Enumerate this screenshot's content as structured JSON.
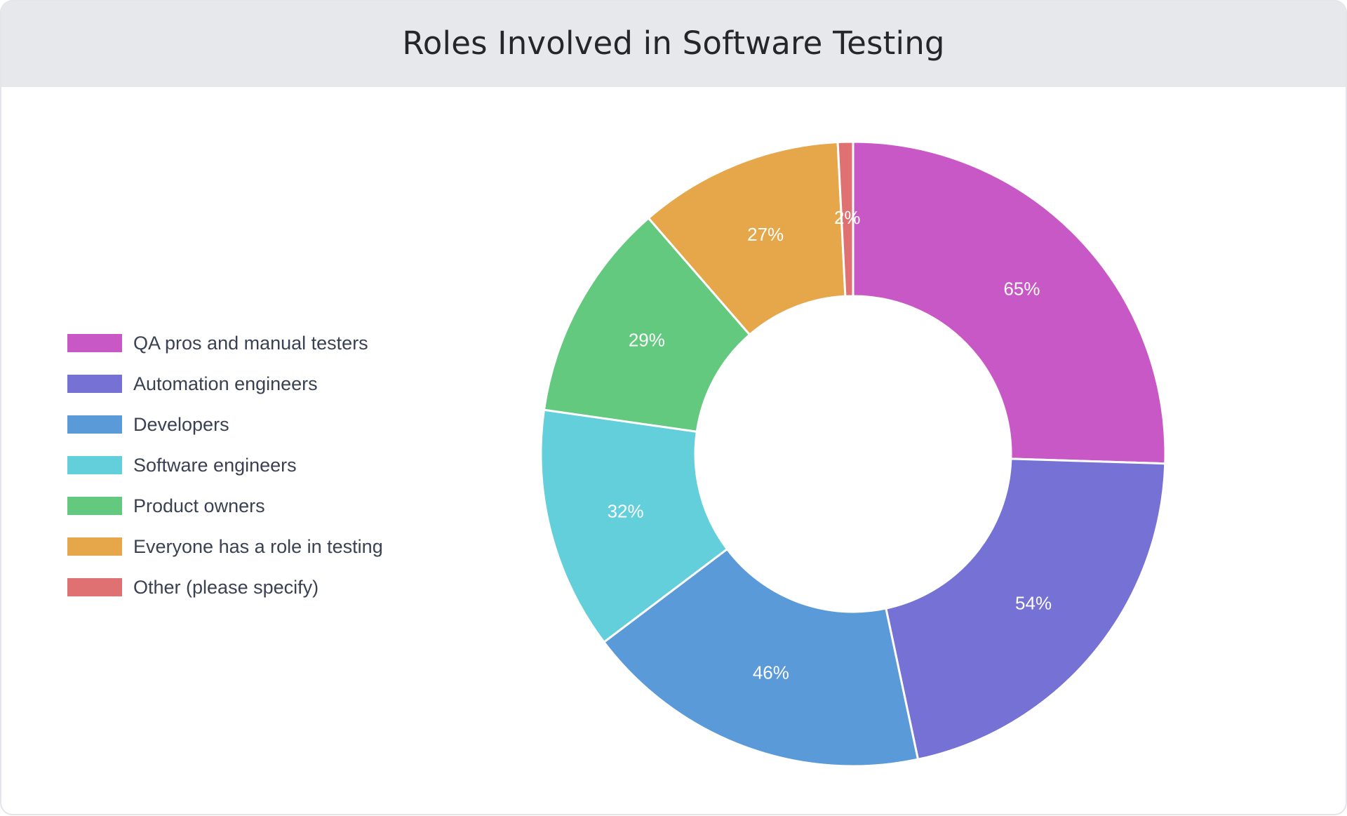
{
  "header": {
    "title": "Roles Involved in Software Testing"
  },
  "chart_data": {
    "type": "pie",
    "variant": "donut",
    "title": "Roles Involved in Software Testing",
    "legend_position": "left",
    "categories": [
      "QA pros and manual testers",
      "Automation engineers",
      "Developers",
      "Software engineers",
      "Product owners",
      "Everyone has a role in testing",
      "Other (please specify)"
    ],
    "values": [
      65,
      54,
      46,
      32,
      29,
      27,
      2
    ],
    "value_labels": [
      "65%",
      "54%",
      "46%",
      "32%",
      "29%",
      "27%",
      "2%"
    ],
    "colors": [
      "#c858c6",
      "#7571d5",
      "#5a9ad8",
      "#62cfda",
      "#63c97e",
      "#e6a64a",
      "#e07173"
    ]
  }
}
